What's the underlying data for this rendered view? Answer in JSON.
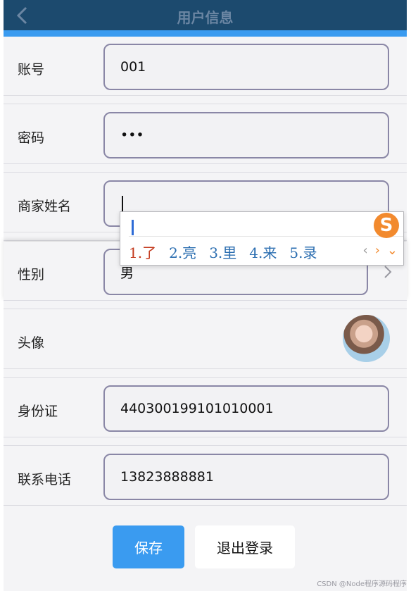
{
  "header": {
    "title": "用户信息"
  },
  "form": {
    "account": {
      "label": "账号",
      "value": "001"
    },
    "password": {
      "label": "密码",
      "value": "•••"
    },
    "merchant_name": {
      "label": "商家姓名",
      "value": ""
    },
    "gender": {
      "label": "性别",
      "value": "男"
    },
    "avatar": {
      "label": "头像"
    },
    "id_card": {
      "label": "身份证",
      "value": "440300199101010001"
    },
    "phone": {
      "label": "联系电话",
      "value": "13823888881"
    }
  },
  "ime": {
    "logo": "S",
    "candidates": [
      "1.了",
      "2.亮",
      "3.里",
      "4.来",
      "5.录"
    ]
  },
  "actions": {
    "save_label": "保存",
    "logout_label": "退出登录"
  },
  "watermark": "CSDN @Node程序源码程序"
}
